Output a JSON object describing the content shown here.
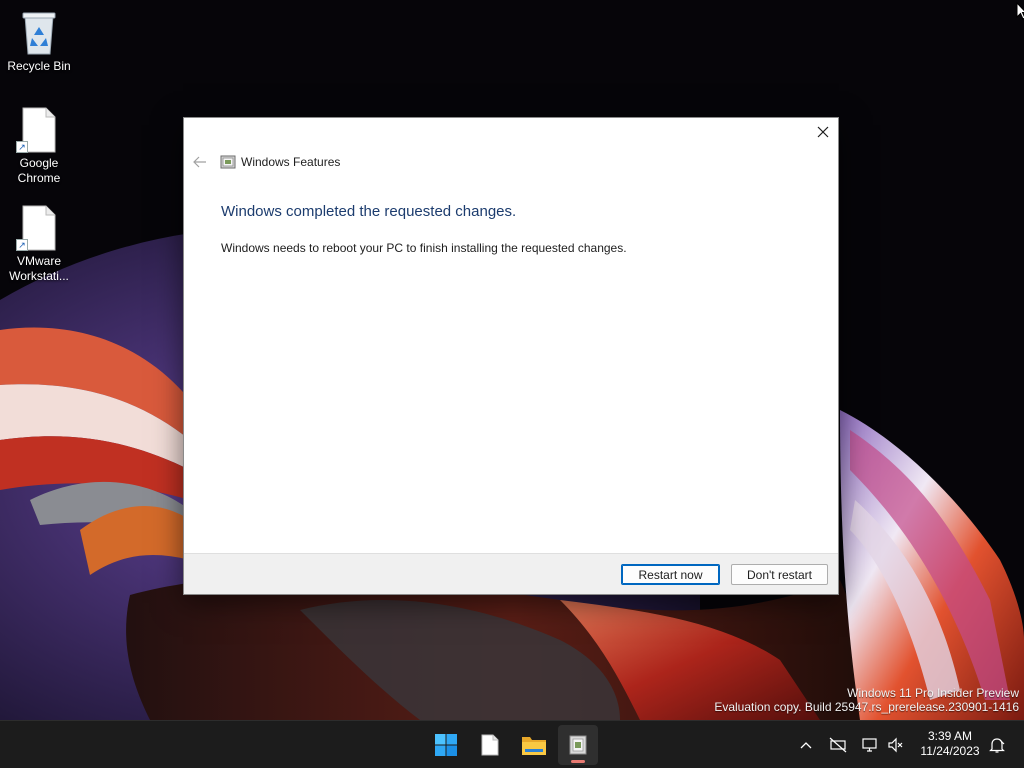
{
  "desktop": {
    "icons": [
      {
        "label": "Recycle Bin",
        "icon": "recycle-bin-icon"
      },
      {
        "label": "Google Chrome",
        "icon": "file-shortcut-icon"
      },
      {
        "label": "VMware Workstati...",
        "icon": "file-shortcut-icon"
      }
    ]
  },
  "dialog": {
    "app_title": "Windows Features",
    "heading": "Windows completed the requested changes.",
    "message": "Windows needs to reboot your PC to finish installing the requested changes.",
    "buttons": {
      "restart_now": "Restart now",
      "dont_restart": "Don't restart"
    }
  },
  "watermark": {
    "line1": "Windows 11 Pro Insider Preview",
    "line2": "Evaluation copy. Build 25947.rs_prerelease.230901-1416"
  },
  "taskbar": {
    "apps": [
      "start-icon",
      "notepad-icon",
      "file-explorer-icon",
      "windows-features-icon"
    ],
    "clock": {
      "time": "3:39 AM",
      "date": "11/24/2023"
    }
  },
  "colors": {
    "heading": "#1c3c6e",
    "accent": "#0067c0",
    "taskbar": "#1c1c1c",
    "dialog_footer": "#f0f0f0"
  }
}
